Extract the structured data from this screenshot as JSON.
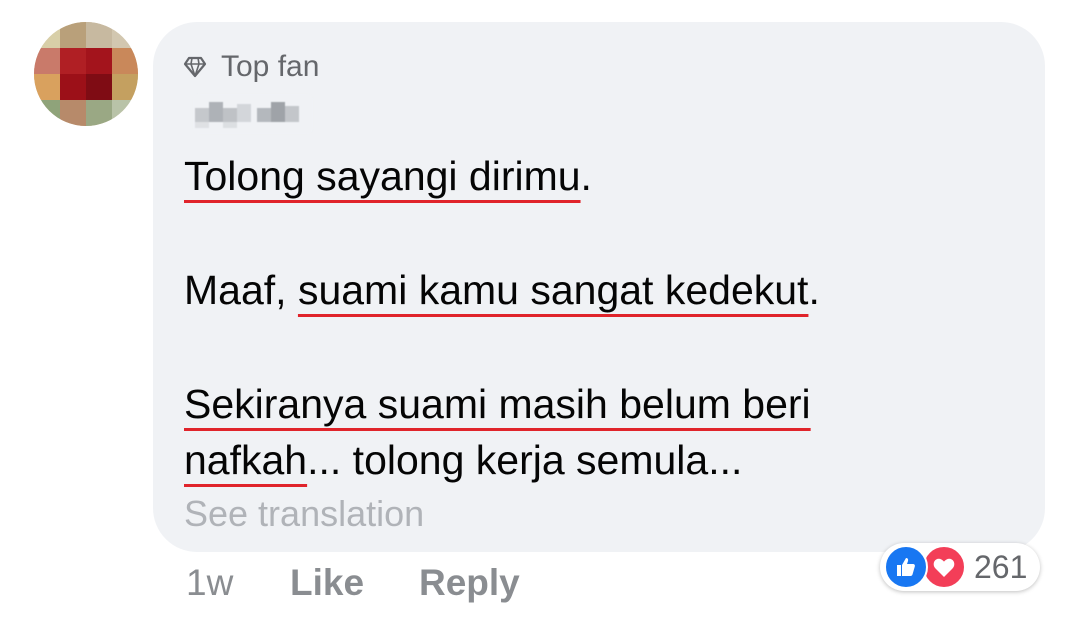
{
  "comment": {
    "badge_label": "Top fan",
    "lines": [
      {
        "underlined": "Tolong sayangi dirimu",
        "after": "."
      },
      {
        "before": "Maaf, ",
        "underlined": "suami kamu sangat kedekut",
        "after": "."
      },
      {
        "underlined": "Sekiranya suami masih belum beri",
        "after": ""
      },
      {
        "underlined": "nafkah",
        "after": "... tolong kerja semula..."
      }
    ],
    "see_translation": "See translation"
  },
  "actions": {
    "time": "1w",
    "like_label": "Like",
    "reply_label": "Reply"
  },
  "reactions": {
    "count": "261",
    "icons": [
      "thumbs-up-icon",
      "heart-icon"
    ]
  },
  "colors": {
    "bubble_bg": "#f0f2f5",
    "spellcheck_underline": "#e0242b",
    "like_blue": "#1877f2",
    "love_red": "#f33e58"
  }
}
